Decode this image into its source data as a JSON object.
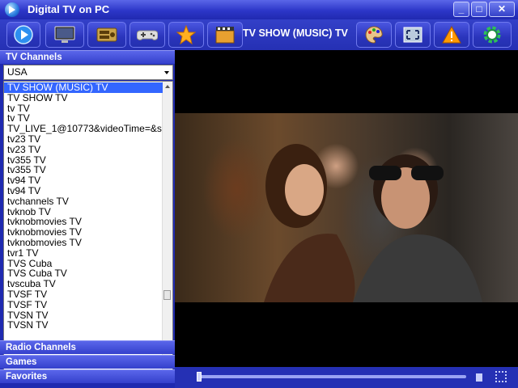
{
  "window": {
    "title": "Digital TV on PC"
  },
  "toolbar": {
    "buttons": [
      {
        "icon": "play-icon"
      },
      {
        "icon": "monitor-icon"
      },
      {
        "icon": "radio-icon"
      },
      {
        "icon": "gamepad-icon"
      },
      {
        "icon": "star-icon"
      },
      {
        "icon": "film-icon"
      },
      {
        "icon": "palette-icon"
      },
      {
        "icon": "screenshot-icon"
      },
      {
        "icon": "warning-icon"
      },
      {
        "icon": "settings-icon"
      }
    ],
    "now_playing": "TV SHOW (MUSIC) TV"
  },
  "sidebar": {
    "tv_header": "TV Channels",
    "country_select": "USA",
    "channels": [
      "TV SHOW (MUSIC) TV",
      "TV SHOW TV",
      "tv TV",
      "tv TV",
      "TV_LIVE_1@10773&videoTime=&s",
      "tv23 TV",
      "tv23 TV",
      "tv355 TV",
      "tv355 TV",
      "tv94 TV",
      "tv94 TV",
      "tvchannels TV",
      "tvknob TV",
      "tvknobmovies TV",
      "tvknobmovies TV",
      "tvknobmovies TV",
      "tvr1 TV",
      "TVS Cuba",
      "TVS Cuba TV",
      "tvscuba TV",
      "TVSF TV",
      "TVSF TV",
      "TVSN TV",
      "TVSN TV"
    ],
    "selected_index": 0,
    "radio_header": "Radio Channels",
    "games_header": "Games",
    "favorites_header": "Favorites"
  },
  "colors": {
    "accent": "#2530b4",
    "selection": "#3366ff"
  }
}
